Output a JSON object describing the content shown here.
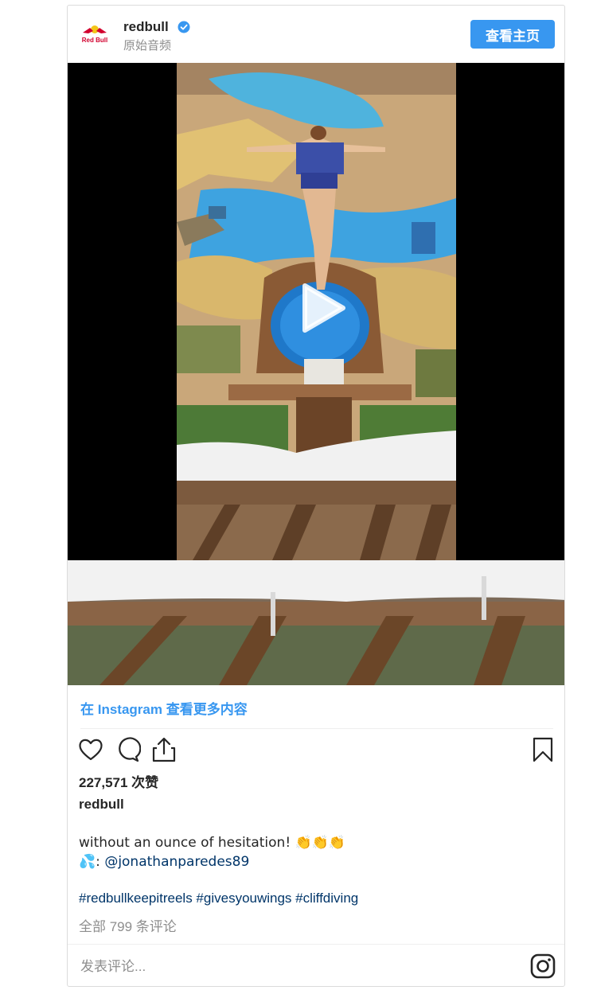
{
  "post": {
    "username": "redbull",
    "audio_label": "原始音频",
    "view_profile_label": "查看主页",
    "more_link": "在 Instagram 查看更多内容",
    "likes": "227,571 次赞",
    "caption_owner": "redbull",
    "caption_line1": "without an ounce of hesitation! 👏👏👏",
    "caption_line2_prefix": "💦: ",
    "caption_mention": "@jonathanparedes89",
    "hashtags": "#redbullkeepitreels #givesyouwings #cliffdiving",
    "comments_count": "全部 799 条评论",
    "comment_placeholder": "发表评论...",
    "logo_text": "Red Bull"
  },
  "icons": {
    "verified": "verified-badge-icon",
    "like": "heart-icon",
    "comment": "speech-bubble-icon",
    "share": "share-icon",
    "save": "bookmark-icon",
    "instagram": "instagram-icon",
    "play": "play-icon"
  },
  "colors": {
    "accent": "#3897f0",
    "link": "#003569",
    "muted": "#8e8e8e",
    "border": "#dbdbdb"
  }
}
